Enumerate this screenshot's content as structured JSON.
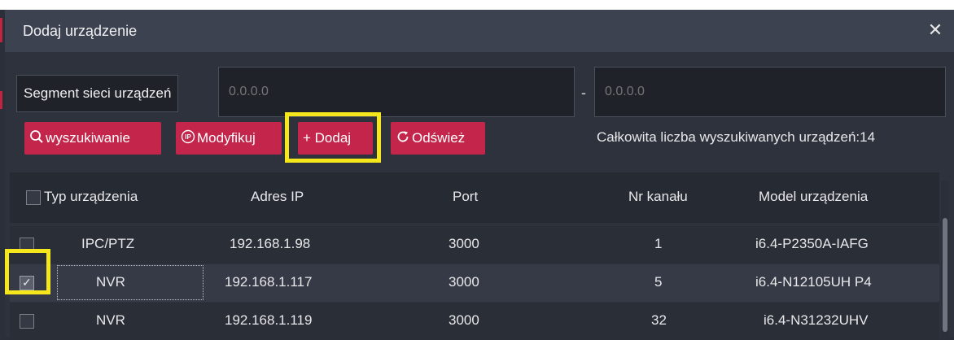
{
  "dialog": {
    "title": "Dodaj urządzenie",
    "close_icon": "close-icon"
  },
  "segment": {
    "label": "Segment sieci urządzeń",
    "from_placeholder": "0.0.0.0",
    "separator": "-",
    "to_placeholder": "0.0.0.0"
  },
  "toolbar": {
    "search_label": "wyszukiwanie",
    "search_icon": "search-icon",
    "modify_label": "Modyfikuj",
    "modify_icon": "ip-icon",
    "add_label": "+ Dodaj",
    "refresh_label": "Odśwież",
    "refresh_icon": "refresh-icon",
    "total_text": "Całkowita liczba wyszukiwanych urządzeń:14"
  },
  "table": {
    "headers": [
      "Typ urządzenia",
      "Adres IP",
      "Port",
      "Nr kanału",
      "Model urządzenia"
    ],
    "rows": [
      {
        "type": "IPC/PTZ",
        "ip": "192.168.1.98",
        "port": "3000",
        "channels": "1",
        "model": "i6.4-P2350A-IAFG",
        "checked": false
      },
      {
        "type": "NVR",
        "ip": "192.168.1.117",
        "port": "3000",
        "channels": "5",
        "model": "i6.4-N12105UH P4",
        "checked": true
      },
      {
        "type": "NVR",
        "ip": "192.168.1.119",
        "port": "3000",
        "channels": "32",
        "model": "i6.4-N31232UHV",
        "checked": false
      }
    ]
  },
  "colors": {
    "accent": "#c3264a",
    "highlight": "#f5e71c",
    "background": "#2e323c"
  }
}
